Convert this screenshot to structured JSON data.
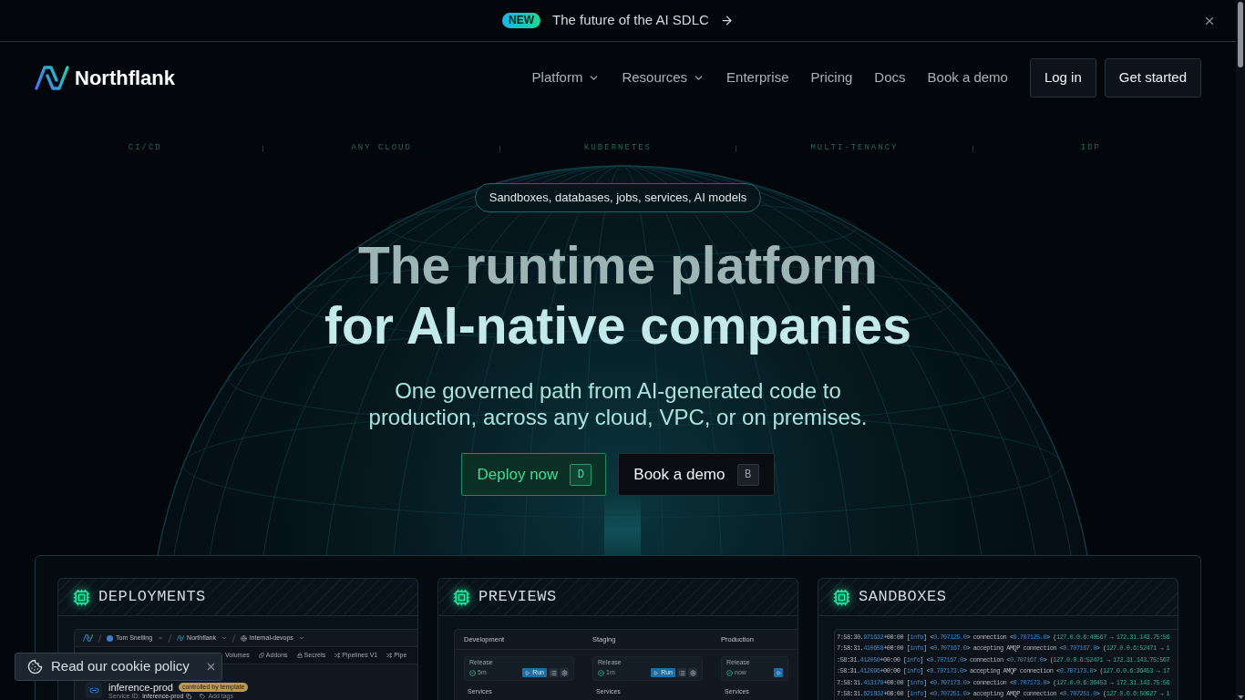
{
  "announcement": {
    "badge": "NEW",
    "text": "The future of the AI SDLC"
  },
  "nav": {
    "brand": "Northflank",
    "links": [
      {
        "label": "Platform",
        "has_menu": true
      },
      {
        "label": "Resources",
        "has_menu": true
      },
      {
        "label": "Enterprise",
        "has_menu": false
      },
      {
        "label": "Pricing",
        "has_menu": false
      },
      {
        "label": "Docs",
        "has_menu": false
      },
      {
        "label": "Book a demo",
        "has_menu": false
      }
    ],
    "buttons": [
      {
        "label": "Log in"
      },
      {
        "label": "Get started"
      }
    ]
  },
  "features": [
    "CI/CD",
    "ANY CLOUD",
    "KUBERNETES",
    "MULTI-TENANCY",
    "IDP"
  ],
  "hero": {
    "pill": "Sandboxes, databases, jobs, services, AI models",
    "title_lines": [
      "The runtime platform",
      "for AI-native companies"
    ],
    "subtitle": "One governed path from AI-generated code to production, across any cloud, VPC, or on premises.",
    "actions": [
      {
        "label": "Deploy now",
        "key": "D",
        "kind": "primary"
      },
      {
        "label": "Book a demo",
        "key": "B",
        "kind": "secondary"
      }
    ]
  },
  "showcase": [
    {
      "title": "DEPLOYMENTS",
      "kind": "deployments",
      "breadcrumbs": [
        {
          "label": "Tom Snelling",
          "kind": "user"
        },
        {
          "label": "Northflank",
          "kind": "team"
        },
        {
          "label": "internal-devops",
          "kind": "project"
        }
      ],
      "tabs": [
        {
          "label": "Volumes",
          "kind": "plain"
        },
        {
          "label": "Addons",
          "kind": "addons"
        },
        {
          "label": "Secrets",
          "kind": "secrets"
        },
        {
          "label": "Pipelines V1",
          "kind": "pipeline"
        },
        {
          "label": "Pipe",
          "kind": "pipeline"
        }
      ],
      "service": {
        "name": "inference-prod",
        "badge": "controlled by template",
        "id_label": "Service ID:",
        "id_value": "inference-prod",
        "add_tags": "Add tags"
      }
    },
    {
      "title": "PREVIEWS",
      "kind": "previews",
      "columns": [
        {
          "name": "Development",
          "label": "Release",
          "status": "5m",
          "run": "Run",
          "tools": true,
          "section": "Services"
        },
        {
          "name": "Staging",
          "label": "Release",
          "status": "1m",
          "run": "Run",
          "tools": true,
          "section": "Services"
        },
        {
          "name": "Production",
          "label": "Release",
          "status": "now",
          "tools": false,
          "section": "Services"
        }
      ]
    },
    {
      "title": "SANDBOXES",
      "kind": "sandboxes",
      "log_lines": [
        {
          "segments": [
            {
              "text": "7:58:30.",
              "kind": "plain"
            },
            {
              "text": "971632",
              "kind": "accent"
            },
            {
              "text": "+00:00 [",
              "kind": "plain"
            },
            {
              "text": "info",
              "kind": "accent"
            },
            {
              "text": "] <",
              "kind": "plain"
            },
            {
              "text": "0.707125.0",
              "kind": "accent"
            },
            {
              "text": "> connection <",
              "kind": "plain"
            },
            {
              "text": "0.707125.0",
              "kind": "accent"
            },
            {
              "text": "> (",
              "kind": "plain"
            },
            {
              "text": "127.0.0.6:40567",
              "kind": "success"
            },
            {
              "text": " → ",
              "kind": "plain"
            },
            {
              "text": "172.31.143.75:56",
              "kind": "success"
            }
          ]
        },
        {
          "segments": [
            {
              "text": "7:58:31.",
              "kind": "plain"
            },
            {
              "text": "410658",
              "kind": "accent"
            },
            {
              "text": "+00:00 [",
              "kind": "plain"
            },
            {
              "text": "info",
              "kind": "accent"
            },
            {
              "text": "] <",
              "kind": "plain"
            },
            {
              "text": "0.707167.0",
              "kind": "accent"
            },
            {
              "text": "> accepting AMQP connection <",
              "kind": "plain"
            },
            {
              "text": "0.707167.0",
              "kind": "accent"
            },
            {
              "text": "> (",
              "kind": "plain"
            },
            {
              "text": "127.0.0.6:52471",
              "kind": "success"
            },
            {
              "text": " → ",
              "kind": "plain"
            },
            {
              "text": "1",
              "kind": "success"
            }
          ]
        },
        {
          "segments": [
            {
              "text": ":58:31.",
              "kind": "plain"
            },
            {
              "text": "412050",
              "kind": "accent"
            },
            {
              "text": "+00:00 [",
              "kind": "plain"
            },
            {
              "text": "info",
              "kind": "accent"
            },
            {
              "text": "] <",
              "kind": "plain"
            },
            {
              "text": "0.707167.0",
              "kind": "accent"
            },
            {
              "text": "> connection <",
              "kind": "plain"
            },
            {
              "text": "0.707167.0",
              "kind": "accent"
            },
            {
              "text": "> (",
              "kind": "plain"
            },
            {
              "text": "127.0.0.6:52471",
              "kind": "success"
            },
            {
              "text": " → ",
              "kind": "plain"
            },
            {
              "text": "172.31.143.75:567",
              "kind": "success"
            }
          ]
        },
        {
          "segments": [
            {
              "text": ":58:31.",
              "kind": "plain"
            },
            {
              "text": "412096",
              "kind": "accent"
            },
            {
              "text": "+00:00 [",
              "kind": "plain"
            },
            {
              "text": "info",
              "kind": "accent"
            },
            {
              "text": "] <",
              "kind": "plain"
            },
            {
              "text": "0.707173.0",
              "kind": "accent"
            },
            {
              "text": "> accepting AMQP connection <",
              "kind": "plain"
            },
            {
              "text": "0.707173.0",
              "kind": "accent"
            },
            {
              "text": "> (",
              "kind": "plain"
            },
            {
              "text": "127.0.0.6:36453",
              "kind": "success"
            },
            {
              "text": " → ",
              "kind": "plain"
            },
            {
              "text": "17",
              "kind": "success"
            }
          ]
        },
        {
          "segments": [
            {
              "text": "7:58:31.",
              "kind": "plain"
            },
            {
              "text": "413179",
              "kind": "accent"
            },
            {
              "text": "+00:00 [",
              "kind": "plain"
            },
            {
              "text": "info",
              "kind": "accent"
            },
            {
              "text": "] <",
              "kind": "plain"
            },
            {
              "text": "0.707173.0",
              "kind": "accent"
            },
            {
              "text": "> connection <",
              "kind": "plain"
            },
            {
              "text": "0.707173.0",
              "kind": "accent"
            },
            {
              "text": "> (",
              "kind": "plain"
            },
            {
              "text": "127.0.0.6:36453",
              "kind": "success"
            },
            {
              "text": " → ",
              "kind": "plain"
            },
            {
              "text": "172.31.143.75:56",
              "kind": "success"
            }
          ]
        },
        {
          "segments": [
            {
              "text": "7:58:31.",
              "kind": "plain"
            },
            {
              "text": "621832",
              "kind": "accent"
            },
            {
              "text": "+00:00 [",
              "kind": "plain"
            },
            {
              "text": "info",
              "kind": "accent"
            },
            {
              "text": "] <",
              "kind": "plain"
            },
            {
              "text": "0.707251.0",
              "kind": "accent"
            },
            {
              "text": "> accepting AMQP connection <",
              "kind": "plain"
            },
            {
              "text": "0.707251.0",
              "kind": "accent"
            },
            {
              "text": "> (",
              "kind": "plain"
            },
            {
              "text": "127.0.0.6:50927",
              "kind": "success"
            },
            {
              "text": " → ",
              "kind": "plain"
            },
            {
              "text": "1",
              "kind": "success"
            }
          ]
        }
      ]
    }
  ],
  "cookie_banner": {
    "text": "Read our cookie policy"
  }
}
